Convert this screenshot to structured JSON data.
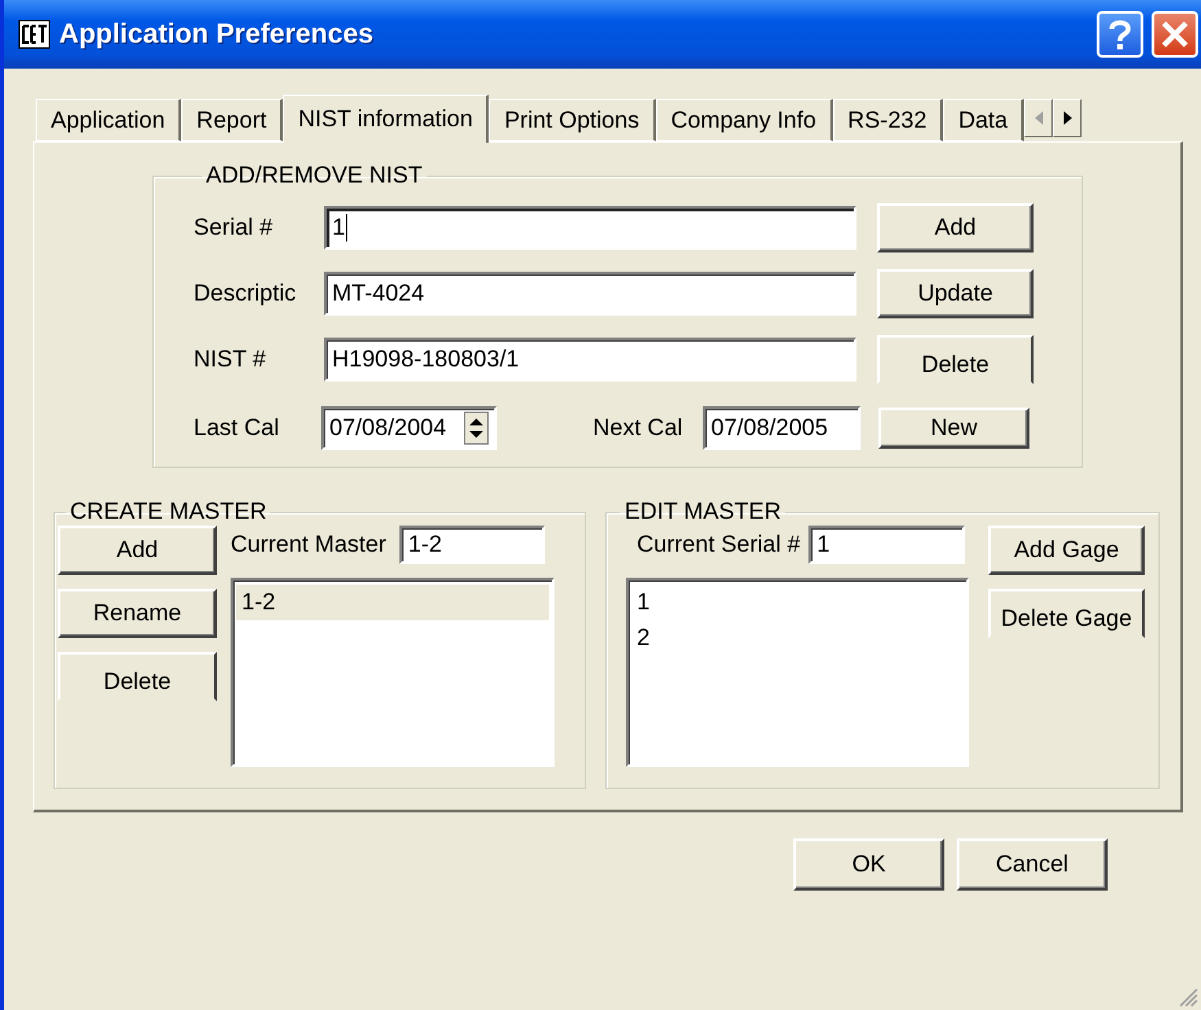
{
  "window": {
    "title": "Application Preferences"
  },
  "tabs": [
    {
      "label": "Application",
      "selected": false
    },
    {
      "label": "Report",
      "selected": false
    },
    {
      "label": "NIST information",
      "selected": true
    },
    {
      "label": "Print Options",
      "selected": false
    },
    {
      "label": "Company Info",
      "selected": false
    },
    {
      "label": "RS-232",
      "selected": false
    },
    {
      "label": "Data",
      "selected": false
    }
  ],
  "add_remove_nist": {
    "title": "ADD/REMOVE NIST",
    "fields": [
      {
        "label": "Serial #",
        "value": "1",
        "focused": true
      },
      {
        "label": "Descriptic",
        "value": "MT-4024",
        "focused": false
      },
      {
        "label": "NIST #",
        "value": "H19098-180803/1",
        "focused": false
      }
    ],
    "buttons": [
      "Add",
      "Update",
      "Delete",
      "New"
    ],
    "last_cal": {
      "label": "Last Cal",
      "value": "07/08/2004"
    },
    "next_cal": {
      "label": "Next Cal",
      "value": "07/08/2005"
    }
  },
  "create_master": {
    "title": "CREATE MASTER",
    "buttons": [
      "Add",
      "Rename",
      "Delete"
    ],
    "current_master": {
      "label": "Current Master",
      "value": "1-2"
    },
    "items": [
      {
        "text": "1-2",
        "selected": true
      }
    ]
  },
  "edit_master": {
    "title": "EDIT MASTER",
    "current_serial": {
      "label": "Current Serial #",
      "value": "1"
    },
    "buttons": [
      "Add Gage",
      "Delete Gage"
    ],
    "items": [
      {
        "text": "1",
        "selected": false
      },
      {
        "text": "2",
        "selected": false
      }
    ]
  },
  "dialog_buttons": [
    "OK",
    "Cancel"
  ]
}
